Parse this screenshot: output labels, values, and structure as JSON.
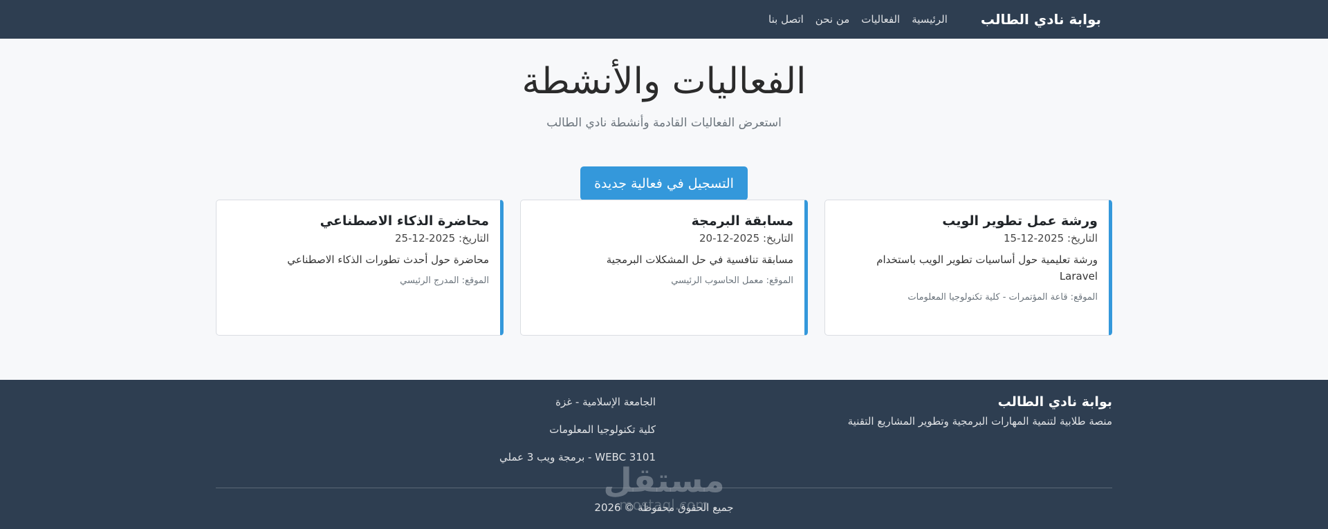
{
  "navbar": {
    "brand": "بوابة نادي الطالب",
    "links": [
      "الرئيسية",
      "الفعاليات",
      "من نحن",
      "اتصل بنا"
    ]
  },
  "hero": {
    "title": "الفعاليات والأنشطة",
    "subtitle": "استعرض الفعاليات القادمة وأنشطة نادي الطالب"
  },
  "cta": {
    "label": "التسجيل في فعالية جديدة"
  },
  "events": [
    {
      "title": "ورشة عمل تطوير الويب",
      "date": "التاريخ: 2025-12-15",
      "description": "ورشة تعليمية حول أساسيات تطوير الويب باستخدام Laravel",
      "location": "الموقع: قاعة المؤتمرات - كلية تكنولوجيا المعلومات"
    },
    {
      "title": "مسابقة البرمجة",
      "date": "التاريخ: 2025-12-20",
      "description": "مسابقة تنافسية في حل المشكلات البرمجية",
      "location": "الموقع: معمل الحاسوب الرئيسي"
    },
    {
      "title": "محاضرة الذكاء الاصطناعي",
      "date": "التاريخ: 2025-12-25",
      "description": "محاضرة حول أحدث تطورات الذكاء الاصطناعي",
      "location": "الموقع: المدرج الرئيسي"
    }
  ],
  "footer": {
    "title": "بوابة نادي الطالب",
    "description": "منصة طلابية لتنمية المهارات البرمجية وتطوير المشاريع التقنية",
    "lines": [
      "الجامعة الإسلامية - غزة",
      "كلية تكنولوجيا المعلومات",
      "WEBC 3101 - برمجة ويب 3 عملي"
    ],
    "copyright": "جميع الحقوق محفوظة © 2026"
  },
  "watermark": {
    "text": "مستقل",
    "subtext": "mostaql.com"
  },
  "colors": {
    "navbar": "#2e3e51",
    "accent": "#3498db",
    "background": "#f7f8fa"
  }
}
